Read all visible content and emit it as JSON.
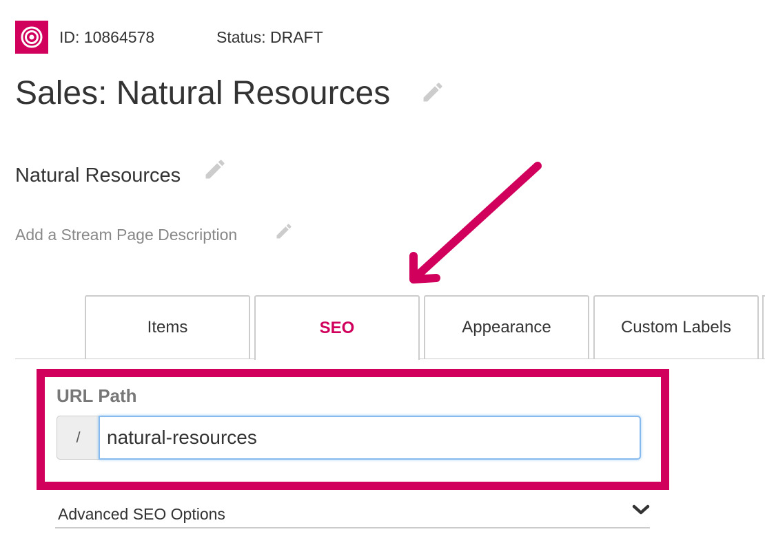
{
  "header": {
    "id_text": "ID: 10864578",
    "status_text": "Status: DRAFT"
  },
  "page": {
    "title": "Sales: Natural Resources",
    "subtitle": "Natural Resources",
    "description_placeholder": "Add a Stream Page Description"
  },
  "tabs": [
    {
      "label": "Items",
      "active": false
    },
    {
      "label": "SEO",
      "active": true
    },
    {
      "label": "Appearance",
      "active": false
    },
    {
      "label": "Custom Labels",
      "active": false
    }
  ],
  "seo": {
    "url_label": "URL Path",
    "url_prefix": "/",
    "url_value": "natural-resources",
    "advanced_label": "Advanced SEO Options"
  },
  "icons": {
    "logo": "target-icon",
    "edit": "pencil-icon",
    "expand": "chevron-down-icon"
  },
  "colors": {
    "accent": "#d0005c",
    "text": "#333333",
    "muted": "#888888",
    "border": "#cccccc",
    "focus": "#86b9ee"
  }
}
